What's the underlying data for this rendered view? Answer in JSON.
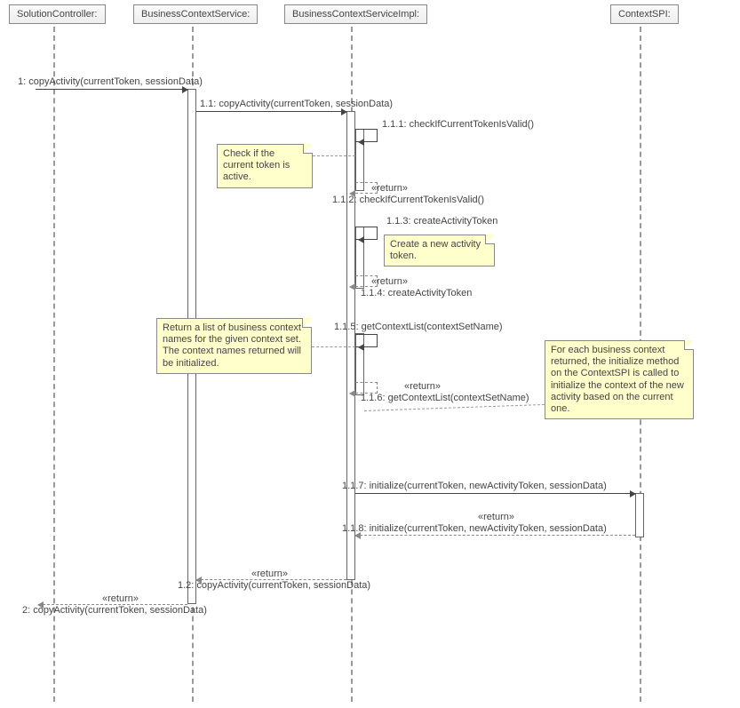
{
  "participants": {
    "p1": "SolutionController:",
    "p2": "BusinessContextService:",
    "p3": "BusinessContextServiceImpl:",
    "p4": "ContextSPI:"
  },
  "messages": {
    "m1": "1: copyActivity(currentToken, sessionData)",
    "m1_1": "1.1: copyActivity(currentToken, sessionData)",
    "m1_1_1": "1.1.1: checkIfCurrentTokenIsValid()",
    "m1_1_1r": "«return»",
    "m1_1_2": "1.1.2: checkIfCurrentTokenIsValid()",
    "m1_1_3": "1.1.3: createActivityToken",
    "m1_1_3r": "«return»",
    "m1_1_4": "1.1.4: createActivityToken",
    "m1_1_5": "1.1.5: getContextList(contextSetName)",
    "m1_1_5r": "«return»",
    "m1_1_6": "1.1.6: getContextList(contextSetName)",
    "m1_1_7": "1.1.7: initialize(currentToken, newActivityToken, sessionData)",
    "m1_1_7r": "«return»",
    "m1_1_8": "1.1.8: initialize(currentToken, newActivityToken, sessionData)",
    "m1_2r": "«return»",
    "m1_2": "1.2: copyActivity(currentToken, sessionData)",
    "m2r": "«return»",
    "m2": "2: copyActivity(currentToken, sessionData)"
  },
  "notes": {
    "n1": "Check if the current token is active.",
    "n2": "Create a new activity token.",
    "n3": "Return a list of business context names for the given context set.  The context names returned will be initialized.",
    "n4": "For each business context returned, the initialize method on the ContextSPI is called to initialize the context of the new activity based on the current one."
  }
}
